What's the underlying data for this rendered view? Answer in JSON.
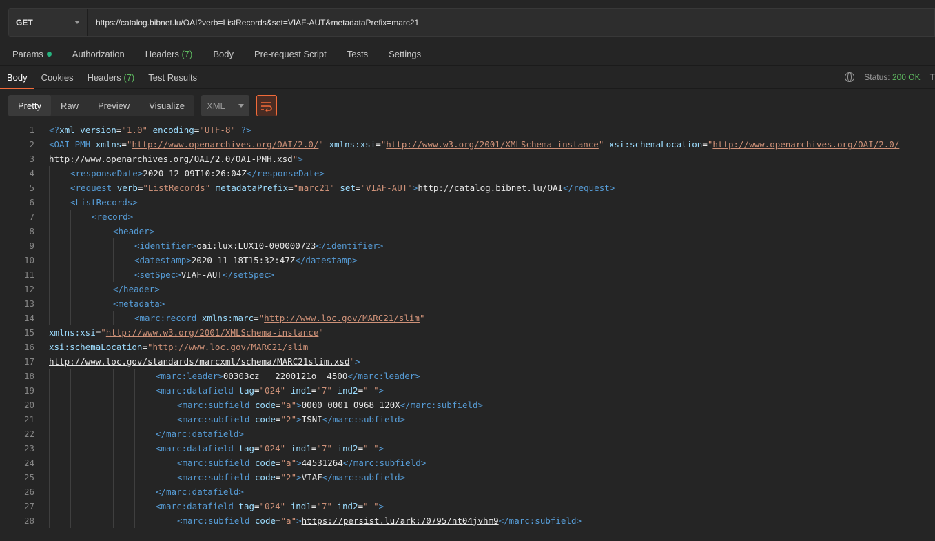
{
  "request": {
    "method": "GET",
    "url": "https://catalog.bibnet.lu/OAI?verb=ListRecords&set=VIAF-AUT&metadataPrefix=marc21"
  },
  "request_tabs": {
    "params": "Params",
    "authorization": "Authorization",
    "headers": "Headers",
    "headers_count": "(7)",
    "body": "Body",
    "prerequest": "Pre-request Script",
    "tests": "Tests",
    "settings": "Settings"
  },
  "response_tabs": {
    "body": "Body",
    "cookies": "Cookies",
    "headers": "Headers",
    "headers_count": "(7)",
    "test_results": "Test Results"
  },
  "status": {
    "label": "Status:",
    "value": "200 OK"
  },
  "view_modes": {
    "pretty": "Pretty",
    "raw": "Raw",
    "preview": "Preview",
    "visualize": "Visualize"
  },
  "format": "XML",
  "colors": {
    "accent": "#f26b3a",
    "status_ok": "#5db85f",
    "tag": "#569cd6",
    "attr": "#9cdcfe",
    "value": "#ce9178"
  },
  "code_lines": [
    {
      "n": "1",
      "indent": 0,
      "t": [
        [
          "tag",
          "<?"
        ],
        [
          "attr",
          "xml"
        ],
        [
          "plain",
          " "
        ],
        [
          "attr",
          "version"
        ],
        [
          "eq",
          "="
        ],
        [
          "val",
          "\"1.0\""
        ],
        [
          "plain",
          " "
        ],
        [
          "attr",
          "encoding"
        ],
        [
          "eq",
          "="
        ],
        [
          "val",
          "\"UTF-8\""
        ],
        [
          "plain",
          " "
        ],
        [
          "tag",
          "?>"
        ]
      ]
    },
    {
      "n": "2",
      "indent": 0,
      "t": [
        [
          "tag",
          "<OAI-PMH"
        ],
        [
          "plain",
          " "
        ],
        [
          "attr",
          "xmlns"
        ],
        [
          "eq",
          "="
        ],
        [
          "val",
          "\""
        ],
        [
          "link",
          "http://www.openarchives.org/OAI/2.0/"
        ],
        [
          "val",
          "\""
        ],
        [
          "plain",
          " "
        ],
        [
          "attr",
          "xmlns:xsi"
        ],
        [
          "eq",
          "="
        ],
        [
          "val",
          "\""
        ],
        [
          "link",
          "http://www.w3.org/2001/XMLSchema-instance"
        ],
        [
          "val",
          "\""
        ],
        [
          "plain",
          " "
        ],
        [
          "attr",
          "xsi:schemaLocation"
        ],
        [
          "eq",
          "="
        ],
        [
          "val",
          "\""
        ],
        [
          "link",
          "http://www.openarchives.org/OAI/2.0/"
        ]
      ]
    },
    {
      "n": "3",
      "indent": 0,
      "t": [
        [
          "linkw",
          "http://www.openarchives.org/OAI/2.0/OAI-PMH.xsd"
        ],
        [
          "val",
          "\""
        ],
        [
          "tag",
          ">"
        ]
      ]
    },
    {
      "n": "4",
      "indent": 1,
      "t": [
        [
          "tag",
          "<responseDate>"
        ],
        [
          "plain",
          "2020-12-09T10:26:04Z"
        ],
        [
          "tag",
          "</responseDate>"
        ]
      ]
    },
    {
      "n": "5",
      "indent": 1,
      "t": [
        [
          "tag",
          "<request"
        ],
        [
          "plain",
          " "
        ],
        [
          "attr",
          "verb"
        ],
        [
          "eq",
          "="
        ],
        [
          "val",
          "\"ListRecords\""
        ],
        [
          "plain",
          " "
        ],
        [
          "attr",
          "metadataPrefix"
        ],
        [
          "eq",
          "="
        ],
        [
          "val",
          "\"marc21\""
        ],
        [
          "plain",
          " "
        ],
        [
          "attr",
          "set"
        ],
        [
          "eq",
          "="
        ],
        [
          "val",
          "\"VIAF-AUT\""
        ],
        [
          "tag",
          ">"
        ],
        [
          "linkw",
          "http://catalog.bibnet.lu/OAI"
        ],
        [
          "tag",
          "</request>"
        ]
      ]
    },
    {
      "n": "6",
      "indent": 1,
      "t": [
        [
          "tag",
          "<ListRecords>"
        ]
      ]
    },
    {
      "n": "7",
      "indent": 2,
      "t": [
        [
          "tag",
          "<record>"
        ]
      ]
    },
    {
      "n": "8",
      "indent": 3,
      "t": [
        [
          "tag",
          "<header>"
        ]
      ]
    },
    {
      "n": "9",
      "indent": 4,
      "t": [
        [
          "tag",
          "<identifier>"
        ],
        [
          "plain",
          "oai:lux:LUX10-000000723"
        ],
        [
          "tag",
          "</identifier>"
        ]
      ]
    },
    {
      "n": "10",
      "indent": 4,
      "t": [
        [
          "tag",
          "<datestamp>"
        ],
        [
          "plain",
          "2020-11-18T15:32:47Z"
        ],
        [
          "tag",
          "</datestamp>"
        ]
      ]
    },
    {
      "n": "11",
      "indent": 4,
      "t": [
        [
          "tag",
          "<setSpec>"
        ],
        [
          "plain",
          "VIAF-AUT"
        ],
        [
          "tag",
          "</setSpec>"
        ]
      ]
    },
    {
      "n": "12",
      "indent": 3,
      "t": [
        [
          "tag",
          "</header>"
        ]
      ]
    },
    {
      "n": "13",
      "indent": 3,
      "t": [
        [
          "tag",
          "<metadata>"
        ]
      ]
    },
    {
      "n": "14",
      "indent": 4,
      "t": [
        [
          "tag",
          "<marc:record"
        ],
        [
          "plain",
          " "
        ],
        [
          "attr",
          "xmlns:marc"
        ],
        [
          "eq",
          "="
        ],
        [
          "val",
          "\""
        ],
        [
          "link",
          "http://www.loc.gov/MARC21/slim"
        ],
        [
          "val",
          "\""
        ]
      ]
    },
    {
      "n": "15",
      "indent": 0,
      "t": [
        [
          "attr",
          "xmlns:xsi"
        ],
        [
          "eq",
          "="
        ],
        [
          "val",
          "\""
        ],
        [
          "link",
          "http://www.w3.org/2001/XMLSchema-instance"
        ],
        [
          "val",
          "\""
        ]
      ]
    },
    {
      "n": "16",
      "indent": 0,
      "t": [
        [
          "attr",
          "xsi:schemaLocation"
        ],
        [
          "eq",
          "="
        ],
        [
          "val",
          "\""
        ],
        [
          "link",
          "http://www.loc.gov/MARC21/slim"
        ]
      ]
    },
    {
      "n": "17",
      "indent": 0,
      "t": [
        [
          "linkw",
          "http://www.loc.gov/standards/marcxml/schema/MARC21slim.xsd"
        ],
        [
          "val",
          "\""
        ],
        [
          "tag",
          ">"
        ]
      ]
    },
    {
      "n": "18",
      "indent": 5,
      "t": [
        [
          "tag",
          "<marc:leader>"
        ],
        [
          "plain",
          "00303cz   2200121o  4500"
        ],
        [
          "tag",
          "</marc:leader>"
        ]
      ]
    },
    {
      "n": "19",
      "indent": 5,
      "t": [
        [
          "tag",
          "<marc:datafield"
        ],
        [
          "plain",
          " "
        ],
        [
          "attr",
          "tag"
        ],
        [
          "eq",
          "="
        ],
        [
          "val",
          "\"024\""
        ],
        [
          "plain",
          " "
        ],
        [
          "attr",
          "ind1"
        ],
        [
          "eq",
          "="
        ],
        [
          "val",
          "\"7\""
        ],
        [
          "plain",
          " "
        ],
        [
          "attr",
          "ind2"
        ],
        [
          "eq",
          "="
        ],
        [
          "val",
          "\" \""
        ],
        [
          "tag",
          ">"
        ]
      ]
    },
    {
      "n": "20",
      "indent": 6,
      "t": [
        [
          "tag",
          "<marc:subfield"
        ],
        [
          "plain",
          " "
        ],
        [
          "attr",
          "code"
        ],
        [
          "eq",
          "="
        ],
        [
          "val",
          "\"a\""
        ],
        [
          "tag",
          ">"
        ],
        [
          "plain",
          "0000 0001 0968 120X"
        ],
        [
          "tag",
          "</marc:subfield>"
        ]
      ]
    },
    {
      "n": "21",
      "indent": 6,
      "t": [
        [
          "tag",
          "<marc:subfield"
        ],
        [
          "plain",
          " "
        ],
        [
          "attr",
          "code"
        ],
        [
          "eq",
          "="
        ],
        [
          "val",
          "\"2\""
        ],
        [
          "tag",
          ">"
        ],
        [
          "plain",
          "ISNI"
        ],
        [
          "tag",
          "</marc:subfield>"
        ]
      ]
    },
    {
      "n": "22",
      "indent": 5,
      "t": [
        [
          "tag",
          "</marc:datafield>"
        ]
      ]
    },
    {
      "n": "23",
      "indent": 5,
      "t": [
        [
          "tag",
          "<marc:datafield"
        ],
        [
          "plain",
          " "
        ],
        [
          "attr",
          "tag"
        ],
        [
          "eq",
          "="
        ],
        [
          "val",
          "\"024\""
        ],
        [
          "plain",
          " "
        ],
        [
          "attr",
          "ind1"
        ],
        [
          "eq",
          "="
        ],
        [
          "val",
          "\"7\""
        ],
        [
          "plain",
          " "
        ],
        [
          "attr",
          "ind2"
        ],
        [
          "eq",
          "="
        ],
        [
          "val",
          "\" \""
        ],
        [
          "tag",
          ">"
        ]
      ]
    },
    {
      "n": "24",
      "indent": 6,
      "t": [
        [
          "tag",
          "<marc:subfield"
        ],
        [
          "plain",
          " "
        ],
        [
          "attr",
          "code"
        ],
        [
          "eq",
          "="
        ],
        [
          "val",
          "\"a\""
        ],
        [
          "tag",
          ">"
        ],
        [
          "plain",
          "44531264"
        ],
        [
          "tag",
          "</marc:subfield>"
        ]
      ]
    },
    {
      "n": "25",
      "indent": 6,
      "t": [
        [
          "tag",
          "<marc:subfield"
        ],
        [
          "plain",
          " "
        ],
        [
          "attr",
          "code"
        ],
        [
          "eq",
          "="
        ],
        [
          "val",
          "\"2\""
        ],
        [
          "tag",
          ">"
        ],
        [
          "plain",
          "VIAF"
        ],
        [
          "tag",
          "</marc:subfield>"
        ]
      ]
    },
    {
      "n": "26",
      "indent": 5,
      "t": [
        [
          "tag",
          "</marc:datafield>"
        ]
      ]
    },
    {
      "n": "27",
      "indent": 5,
      "t": [
        [
          "tag",
          "<marc:datafield"
        ],
        [
          "plain",
          " "
        ],
        [
          "attr",
          "tag"
        ],
        [
          "eq",
          "="
        ],
        [
          "val",
          "\"024\""
        ],
        [
          "plain",
          " "
        ],
        [
          "attr",
          "ind1"
        ],
        [
          "eq",
          "="
        ],
        [
          "val",
          "\"7\""
        ],
        [
          "plain",
          " "
        ],
        [
          "attr",
          "ind2"
        ],
        [
          "eq",
          "="
        ],
        [
          "val",
          "\" \""
        ],
        [
          "tag",
          ">"
        ]
      ]
    },
    {
      "n": "28",
      "indent": 6,
      "t": [
        [
          "tag",
          "<marc:subfield"
        ],
        [
          "plain",
          " "
        ],
        [
          "attr",
          "code"
        ],
        [
          "eq",
          "="
        ],
        [
          "val",
          "\"a\""
        ],
        [
          "tag",
          ">"
        ],
        [
          "linkw",
          "https://persist.lu/ark:70795/nt04jvhm9"
        ],
        [
          "tag",
          "</marc:subfield>"
        ]
      ]
    }
  ]
}
